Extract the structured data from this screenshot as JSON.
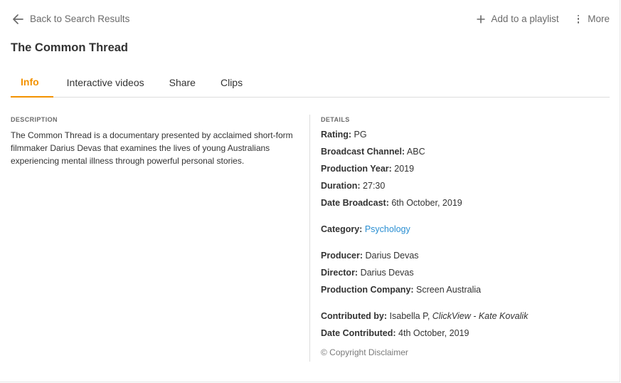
{
  "nav": {
    "back_label": "Back to Search Results",
    "add_playlist_label": "Add to a playlist",
    "more_label": "More"
  },
  "title": "The Common Thread",
  "tabs": [
    {
      "label": "Info",
      "active": true
    },
    {
      "label": "Interactive videos",
      "active": false
    },
    {
      "label": "Share",
      "active": false
    },
    {
      "label": "Clips",
      "active": false
    }
  ],
  "description": {
    "heading": "DESCRIPTION",
    "text": "The Common Thread is a documentary presented by acclaimed short-form filmmaker Darius Devas that examines the lives of young Australians experiencing mental illness through powerful personal stories."
  },
  "details": {
    "heading": "DETAILS",
    "rating": {
      "label": "Rating:",
      "value": "PG"
    },
    "broadcast_channel": {
      "label": "Broadcast Channel:",
      "value": "ABC"
    },
    "production_year": {
      "label": "Production Year:",
      "value": "2019"
    },
    "duration": {
      "label": "Duration:",
      "value": "27:30"
    },
    "date_broadcast": {
      "label": "Date Broadcast:",
      "value": "6th October, 2019"
    },
    "category": {
      "label": "Category:",
      "value": "Psychology"
    },
    "producer": {
      "label": "Producer:",
      "value": "Darius Devas"
    },
    "director": {
      "label": "Director:",
      "value": "Darius Devas"
    },
    "production_company": {
      "label": "Production Company:",
      "value": "Screen Australia"
    },
    "contributed_by": {
      "label": "Contributed by:",
      "value": "Isabella P,",
      "value_italic": "ClickView - Kate Kovalik"
    },
    "date_contributed": {
      "label": "Date Contributed:",
      "value": "4th October, 2019"
    }
  },
  "footer": {
    "copyright": "© Copyright Disclaimer"
  },
  "colors": {
    "accent": "#f39200",
    "link": "#2a8fd2",
    "muted": "#6b6b6b",
    "divider": "#dcdcdc"
  },
  "icons": {
    "back": "arrow-left-icon",
    "add": "plus-icon",
    "more": "more-vertical-icon"
  }
}
